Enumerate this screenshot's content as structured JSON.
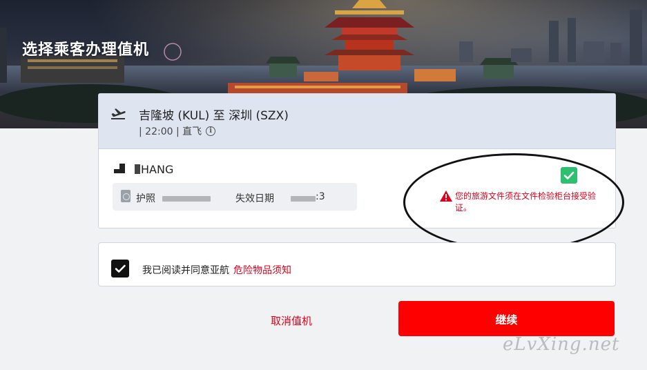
{
  "page": {
    "title": "选择乘客办理值机"
  },
  "flight": {
    "route": "吉隆坡 (KUL) 至 深圳 (SZX)",
    "details": "| 22:00 | 直飞",
    "info_glyph": "i",
    "icon": "plane-departure-icon"
  },
  "passenger": {
    "name_visible": "HANG",
    "passport_label": "护照",
    "expiry_label": "失效日期",
    "expiry_suffix": ":3",
    "status_icon": "check-icon",
    "warning_text": "您的旅游文件须在文件检验柜台接受验证。"
  },
  "agreement": {
    "text": "我已阅读并同意亚航",
    "link": "危险物品须知",
    "checked": true
  },
  "actions": {
    "cancel_label": "取消值机",
    "continue_label": "继续"
  },
  "watermark": "eLvXing.net",
  "colors": {
    "accent": "#ff0000",
    "link": "#e0001b",
    "success": "#2fbf71",
    "header_bg": "#dfe4f1"
  }
}
